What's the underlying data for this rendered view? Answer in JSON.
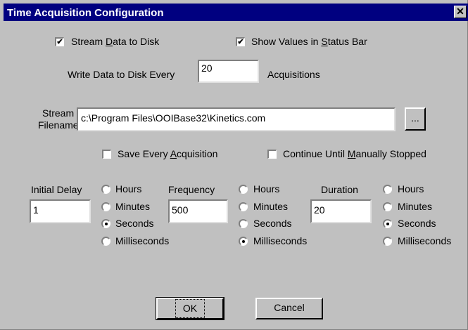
{
  "window": {
    "title": "Time Acquisition Configuration",
    "close_glyph": "✕"
  },
  "checkboxes": {
    "stream_data": {
      "label": "Stream Data to Disk",
      "checked": true
    },
    "show_values": {
      "label": "Show Values in Status Bar",
      "checked": true
    },
    "save_every": {
      "label": "Save Every Acquisition",
      "checked": false
    },
    "continue_until": {
      "label": "Continue Until Manually Stopped",
      "checked": false
    }
  },
  "write_every": {
    "label_before": "Write Data to Disk Every",
    "value": "20",
    "label_after": "Acquisitions"
  },
  "stream_filename": {
    "label_line1": "Stream",
    "label_line2": "Filename",
    "value": "c:\\Program Files\\OOIBase32\\Kinetics.com",
    "browse_label": "..."
  },
  "groups": [
    {
      "label": "Initial Delay",
      "value": "1",
      "selected": "Seconds"
    },
    {
      "label": "Frequency",
      "value": "500",
      "selected": "Milliseconds"
    },
    {
      "label": "Duration",
      "value": "20",
      "selected": "Seconds"
    }
  ],
  "units": [
    "Hours",
    "Minutes",
    "Seconds",
    "Milliseconds"
  ],
  "buttons": {
    "ok": "OK",
    "cancel": "Cancel"
  }
}
